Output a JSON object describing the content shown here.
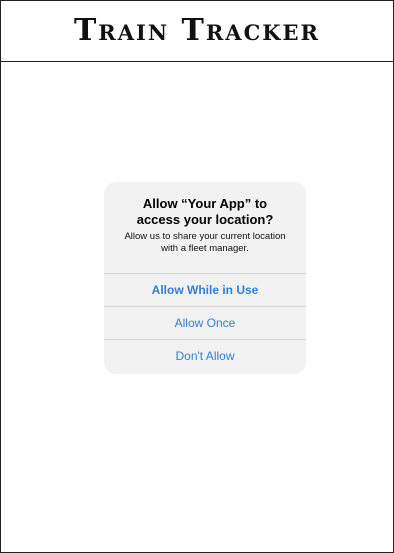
{
  "app": {
    "title": "Train Tracker"
  },
  "permission_alert": {
    "title_line1": "Allow “Your App” to",
    "title_line2": "access your location?",
    "message_line1": "Allow us to share your current location",
    "message_line2": "with a fleet manager.",
    "buttons": [
      {
        "label": "Allow While in Use",
        "style": "primary"
      },
      {
        "label": "Allow Once",
        "style": "default"
      },
      {
        "label": "Don't Allow",
        "style": "default"
      }
    ]
  },
  "colors": {
    "accent": "#2f7fd8",
    "alert_background": "#f2f2f3",
    "separator": "#d6d6d9",
    "border": "#222222"
  }
}
